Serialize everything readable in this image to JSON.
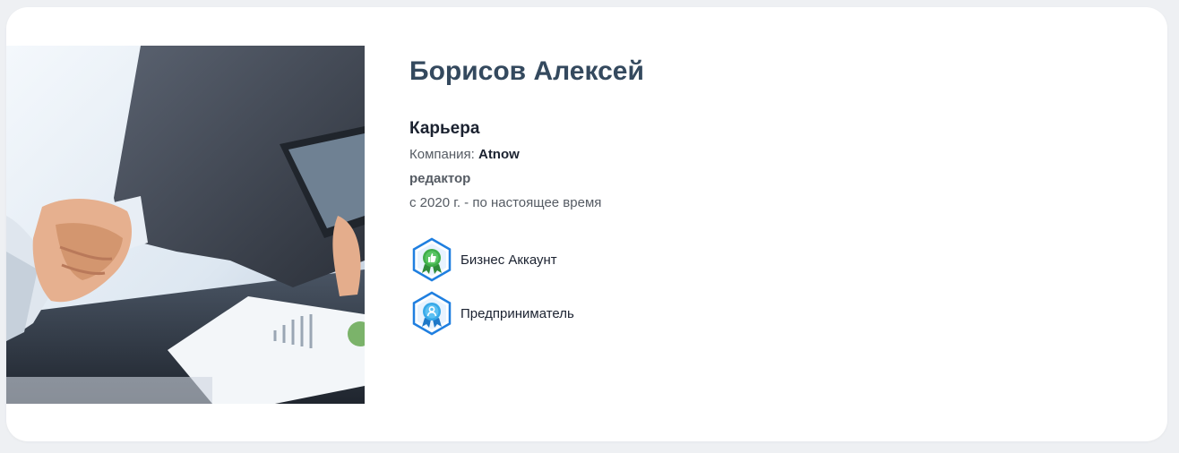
{
  "profile": {
    "name": "Борисов Алексей"
  },
  "career": {
    "title": "Карьера",
    "company_label": "Компания: ",
    "company_name": "Atnow",
    "position": "редактор",
    "period": "с 2020 г. - по настоящее время"
  },
  "badges": [
    {
      "label": "Бизнес Аккаунт",
      "icon": "thumbs-up-badge-icon",
      "color": "#3fae49"
    },
    {
      "label": "Предприниматель",
      "icon": "person-badge-icon",
      "color": "#37a8e8"
    }
  ],
  "colors": {
    "name": "#34495e",
    "badge_frame": "#1f7fe0"
  }
}
